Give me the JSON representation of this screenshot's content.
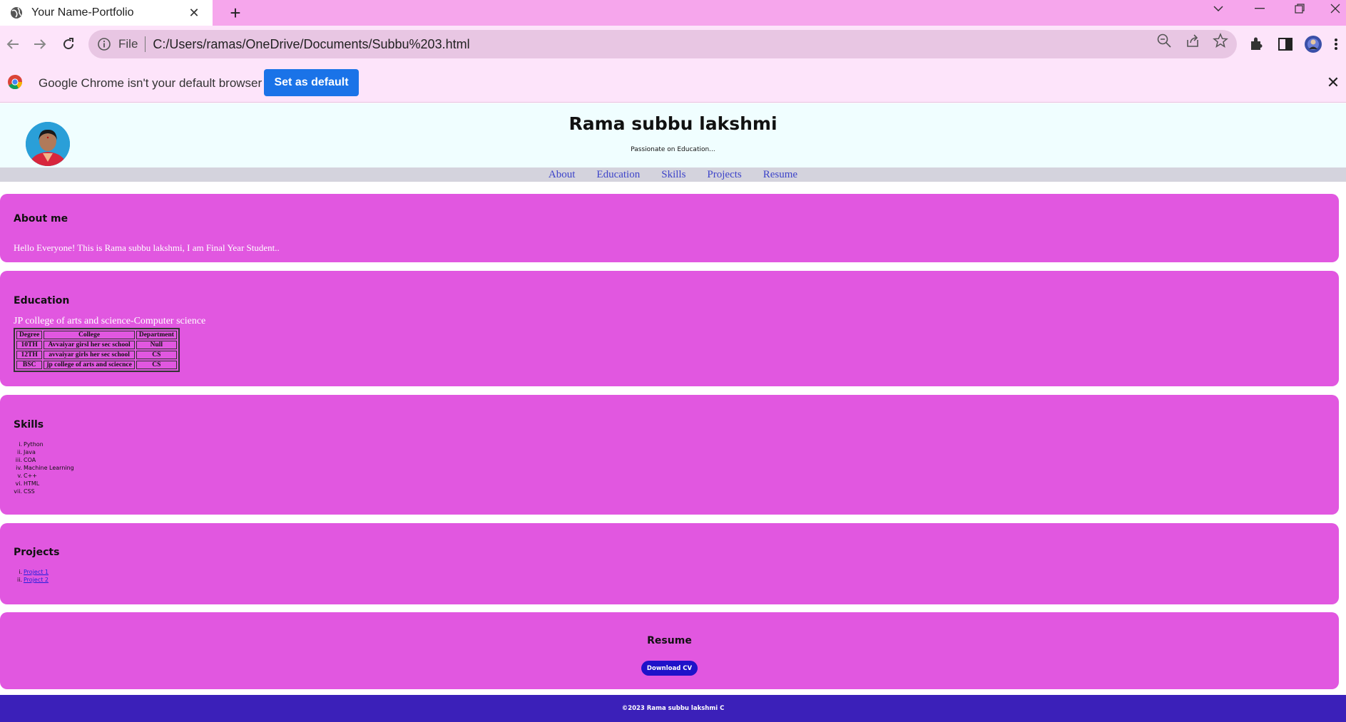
{
  "browser": {
    "tab_title": "Your Name-Portfolio",
    "tab_close": "✕",
    "new_tab": "+",
    "file_label": "File",
    "url": "C:/Users/ramas/OneDrive/Documents/Subbu%203.html",
    "infobar_message": "Google Chrome isn't your default browser",
    "set_default_label": "Set as default",
    "infobar_close": "✕"
  },
  "header": {
    "name": "Rama subbu lakshmi",
    "tagline": "Passionate on Education..."
  },
  "nav": [
    "About",
    "Education",
    "Skills",
    "Projects",
    "Resume"
  ],
  "about": {
    "heading": "About me",
    "text": "Hello Everyone! This is Rama subbu lakshmi, I am Final Year Student.."
  },
  "education": {
    "heading": "Education",
    "line": "JP college of arts and science-Computer science",
    "columns": [
      "Degree",
      "College",
      "Department"
    ],
    "rows": [
      [
        "10TH",
        "Avvaiyar girsl her sec school",
        "Null"
      ],
      [
        "12TH",
        "avvaiyar girls her sec school",
        "CS"
      ],
      [
        "BSC",
        "jp college of arts and sciecnce",
        "CS"
      ]
    ]
  },
  "skills": {
    "heading": "Skills",
    "numerals": [
      "i.",
      "ii.",
      "iii.",
      "iv.",
      "v.",
      "vi.",
      "vii."
    ],
    "items": [
      "Python",
      "Java",
      "COA",
      "Machine Learning",
      "C++",
      "HTML",
      "CSS"
    ]
  },
  "projects": {
    "heading": "Projects",
    "numerals": [
      "i.",
      "ii."
    ],
    "items": [
      "Project 1",
      "Project 2"
    ]
  },
  "resume": {
    "heading": "Resume",
    "button": "Download CV"
  },
  "footer": "©2023 Rama subbu lakshmi C",
  "colors": {
    "tabstrip": "#f6a6ec",
    "toolbar": "#fde4fa",
    "section_bg": "#e157e0",
    "nav_link": "#3d44c9",
    "footer_bg": "#3b20b9",
    "cv_button": "#1f12c9",
    "default_button": "#1a73e8"
  }
}
